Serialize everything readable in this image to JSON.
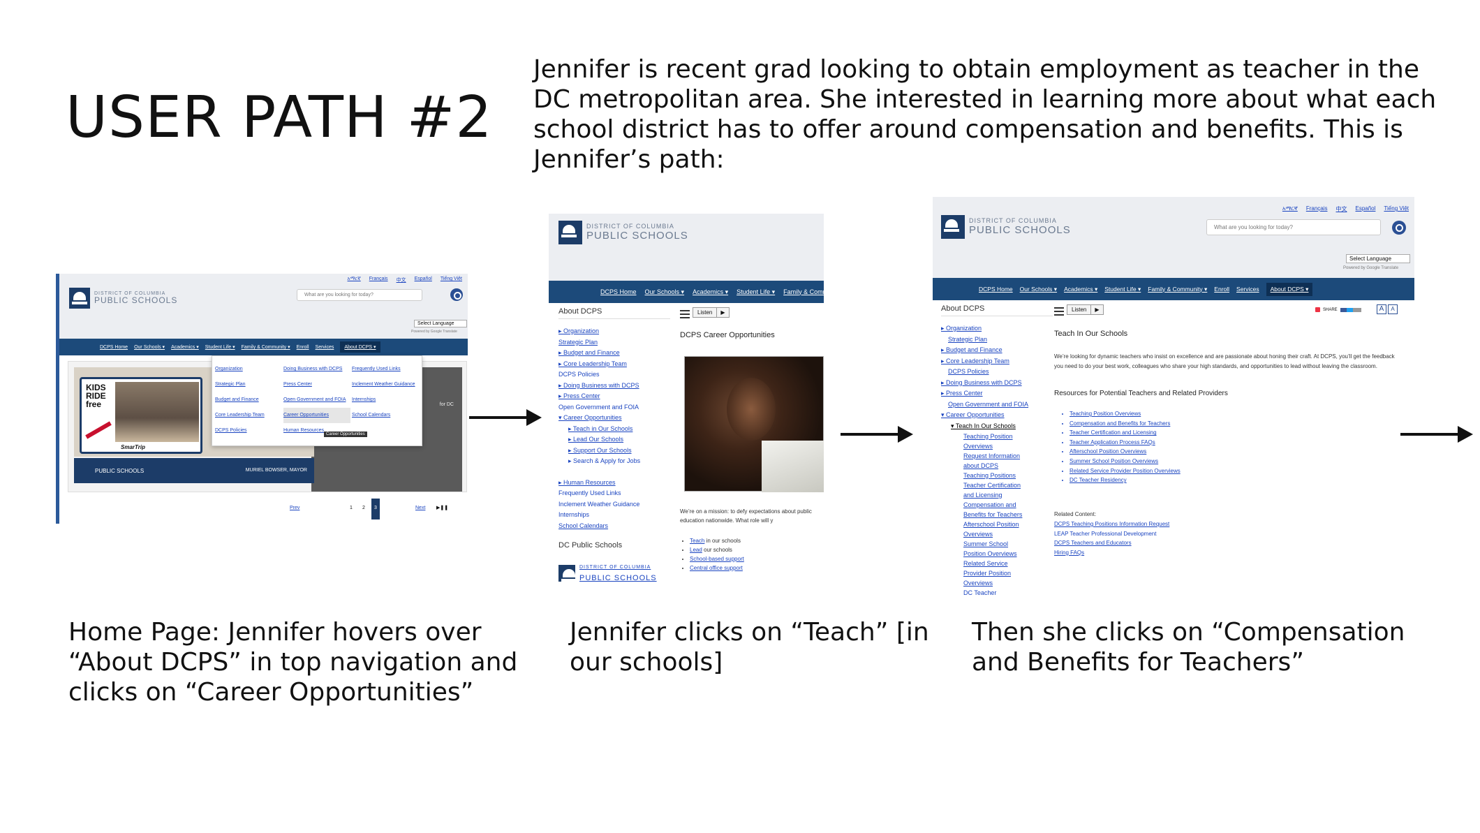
{
  "title": "USER PATH #2",
  "intro": "Jennifer is recent grad looking to obtain employment as teacher in the DC metropolitan area. She interested in learning more about what each school district has to offer around compensation and benefits. This is Jennifer’s path:",
  "captions": [
    "Home Page: Jennifer hovers over “About DCPS” in top navigation and clicks on “Career Opportunities”",
    "Jennifer clicks on “Teach” [in our schools]",
    "Then she clicks on “Compensation and Benefits for Teachers”"
  ],
  "site": {
    "logo_line1": "DISTRICT OF COLUMBIA",
    "logo_line2": "PUBLIC SCHOOLS",
    "search_placeholder": "What are you looking for today?",
    "select_language": "Select Language",
    "powered": "Powered by Google Translate",
    "languages": [
      "አማርኛ",
      "Français",
      "中文",
      "Español",
      "Tiếng Việt"
    ],
    "nav": [
      "DCPS Home",
      "Our Schools ▾",
      "Academics ▾",
      "Student Life ▾",
      "Family & Community ▾",
      "Enroll",
      "Services",
      "About DCPS ▾"
    ],
    "listen": "Listen"
  },
  "screen1": {
    "dropdown_col1": [
      "Organization",
      "Strategic Plan",
      "Budget and Finance",
      "Core Leadership Team",
      "DCPS Policies"
    ],
    "dropdown_col2": [
      "Doing Business with DCPS",
      "Press Center",
      "Open Government and FOIA",
      "Career Opportunities",
      "Human Resources"
    ],
    "dropdown_col3": [
      "Frequently Used Links",
      "Inclement Weather Guidance",
      "Internships",
      "School Calendars"
    ],
    "tooltip": "Career Opportunities",
    "banner_text": "KIDS RIDE free",
    "banner_brand": "SmarTrip",
    "footer_left": "PUBLIC SCHOOLS",
    "footer_right": "MURIEL BOWSER, MAYOR",
    "side_text": "for DC",
    "pager_prev": "Prev",
    "pager_next": "Next",
    "pager_pages": [
      "1",
      "2",
      "3"
    ]
  },
  "screen2": {
    "side_title": "About DCPS",
    "side_links": [
      "▸ Organization",
      "Strategic Plan",
      "▸ Budget and Finance",
      "▸ Core Leadership Team",
      "DCPS Policies",
      "▸ Doing Business with DCPS",
      "▸ Press Center",
      "Open Government and FOIA",
      "▾ Career Opportunities",
      "▸ Teach in Our Schools",
      "▸ Lead Our Schools",
      "▸ Support Our Schools",
      "▸ Search & Apply for Jobs",
      "",
      "▸ Human Resources",
      "Frequently Used Links",
      "Inclement Weather Guidance",
      "Internships",
      "School Calendars"
    ],
    "side_footer": "DC Public Schools",
    "page_title": "DCPS Career Opportunities",
    "mission": "We’re on a mission: to defy expectations about public education nationwide. What role will y",
    "bullets": [
      {
        "link": "Teach",
        "rest": " in our schools"
      },
      {
        "link": "Lead",
        "rest": " our schools"
      },
      {
        "link": "School-based support",
        "rest": ""
      },
      {
        "link": "Central office support",
        "rest": ""
      }
    ]
  },
  "screen3": {
    "side_title": "About DCPS",
    "side_links": [
      "▸ Organization",
      "Strategic Plan",
      "▸ Budget and Finance",
      "▸ Core Leadership Team",
      "DCPS Policies",
      "▸ Doing Business with DCPS",
      "▸ Press Center",
      "Open Government and FOIA",
      "▾ Career Opportunities",
      "▾ Teach In Our Schools",
      "Teaching Position",
      "Overviews",
      "Request Information",
      "about DCPS",
      "Teaching Positions",
      "Teacher Certification",
      "and Licensing",
      "Compensation and",
      "Benefits for Teachers",
      "Afterschool Position",
      "Overviews",
      "Summer School",
      "Position Overviews",
      "Related Service",
      "Provider Position",
      "Overviews",
      "DC Teacher"
    ],
    "page_title": "Teach In Our Schools",
    "share": "SHARE",
    "paragraph": "We’re looking for dynamic teachers who insist on excellence and are passionate about honing their craft. At DCPS, you’ll get the feedback you need to do your best work, colleagues who share your high standards, and opportunities to lead without leaving the classroom.",
    "resources_title": "Resources for Potential Teachers and Related Providers",
    "resources": [
      "Teaching Position Overviews",
      "Compensation and Benefits for Teachers",
      "Teacher Certification and Licensing",
      "Teacher Application Process FAQs",
      "Afterschool Position Overviews",
      "Summer School Position Overviews",
      "Related Service Provider Position Overviews",
      "DC Teacher Residency"
    ],
    "related_title": "Related Content:",
    "related": [
      "DCPS Teaching Positions Information Request",
      "LEAP Teacher Professional Development",
      "DCPS Teachers and Educators",
      "Hiring FAQs"
    ]
  }
}
